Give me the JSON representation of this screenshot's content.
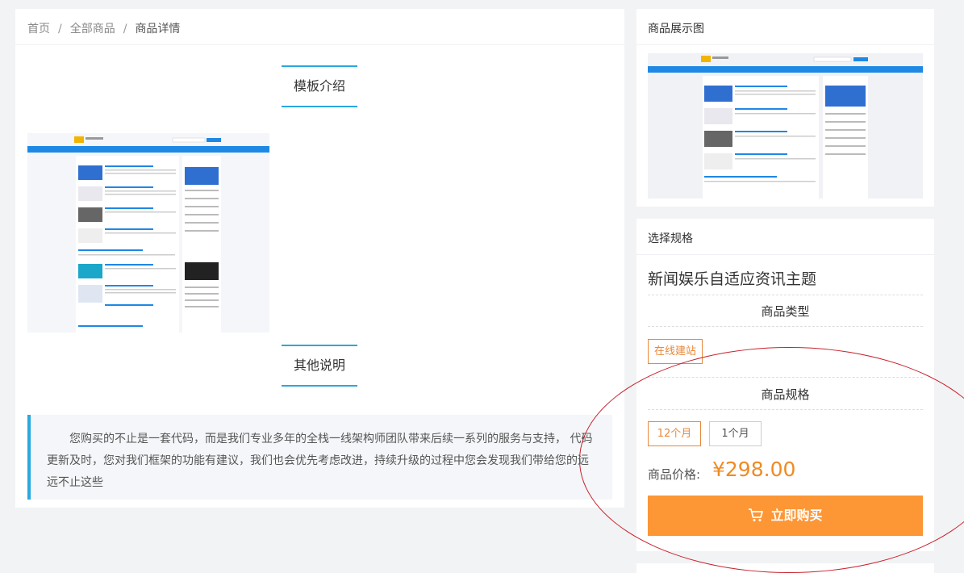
{
  "breadcrumb": {
    "home": "首页",
    "all": "全部商品",
    "current": "商品详情",
    "sep": "/"
  },
  "sections": {
    "intro": "模板介绍",
    "other": "其他说明"
  },
  "note": "您购买的不止是一套代码，而是我们专业多年的全栈一线架构师团队带来后续一系列的服务与支持， 代码更新及时，您对我们框架的功能有建议，我们也会优先考虑改进，持续升级的过程中您会发现我们带给您的远远不止这些",
  "preview_card": {
    "title": "商品展示图"
  },
  "spec_card": {
    "title": "选择规格",
    "product_name": "新闻娱乐自适应资讯主题",
    "type_heading": "商品类型",
    "type_option": "在线建站",
    "spec_heading": "商品规格",
    "spec_options": [
      "12个月",
      "1个月"
    ],
    "price_label": "商品价格:",
    "price_value": "¥298.00",
    "buy_label": "立即购买"
  },
  "colors": {
    "accent_blue": "#29a8de",
    "orange": "#fd9634",
    "annotation_red": "#c8202a"
  }
}
